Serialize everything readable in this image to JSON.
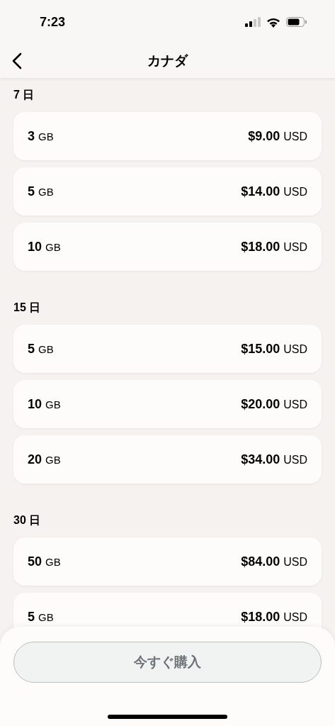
{
  "status_bar": {
    "time": "7:23"
  },
  "header": {
    "title": "カナダ"
  },
  "sections": [
    {
      "label": "7 日",
      "plans": [
        {
          "size": "3",
          "unit": "GB",
          "price": "$9.00",
          "currency": "USD"
        },
        {
          "size": "5",
          "unit": "GB",
          "price": "$14.00",
          "currency": "USD"
        },
        {
          "size": "10",
          "unit": "GB",
          "price": "$18.00",
          "currency": "USD"
        }
      ]
    },
    {
      "label": "15 日",
      "plans": [
        {
          "size": "5",
          "unit": "GB",
          "price": "$15.00",
          "currency": "USD"
        },
        {
          "size": "10",
          "unit": "GB",
          "price": "$20.00",
          "currency": "USD"
        },
        {
          "size": "20",
          "unit": "GB",
          "price": "$34.00",
          "currency": "USD"
        }
      ]
    },
    {
      "label": "30 日",
      "plans": [
        {
          "size": "50",
          "unit": "GB",
          "price": "$84.00",
          "currency": "USD"
        },
        {
          "size": "5",
          "unit": "GB",
          "price": "$18.00",
          "currency": "USD"
        }
      ]
    }
  ],
  "buy_button": {
    "label": "今すぐ購入",
    "disabled": true
  }
}
